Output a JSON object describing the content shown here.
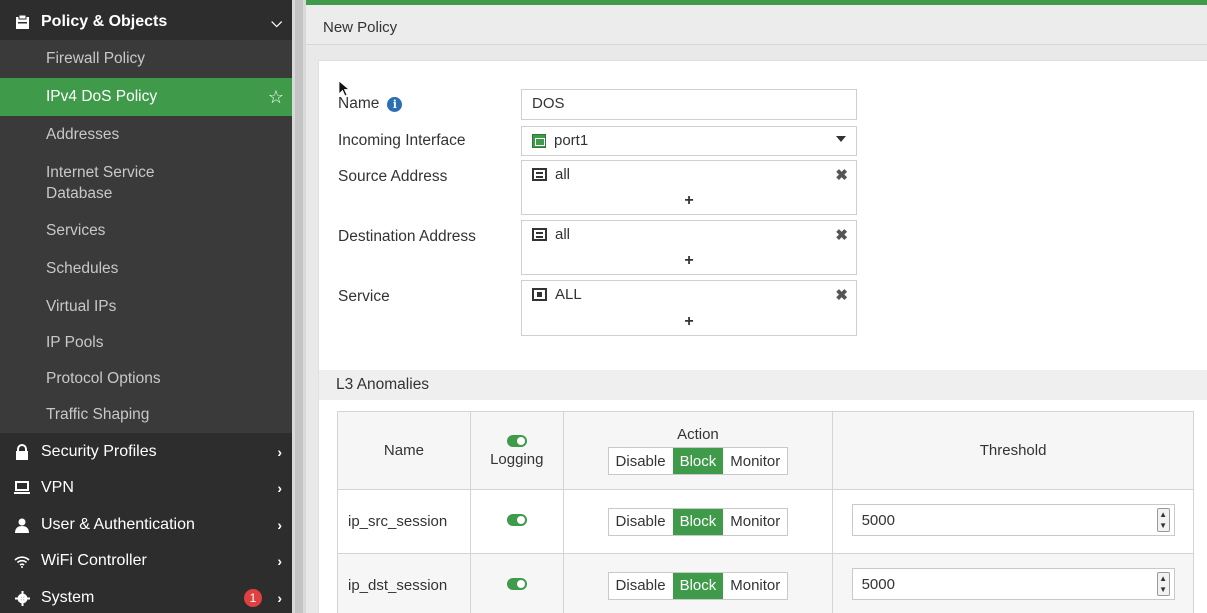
{
  "sidebar": {
    "section": {
      "label": "Policy & Objects",
      "icon": "clipboard-icon"
    },
    "items": [
      {
        "label": "Firewall Policy"
      },
      {
        "label": "IPv4 DoS Policy",
        "active": true
      },
      {
        "label": "Addresses"
      },
      {
        "label": "Internet Service\nDatabase"
      },
      {
        "label": "Services"
      },
      {
        "label": "Schedules"
      },
      {
        "label": "Virtual IPs"
      },
      {
        "label": "IP Pools"
      },
      {
        "label": "Protocol Options"
      },
      {
        "label": "Traffic Shaping"
      }
    ],
    "groups": [
      {
        "label": "Security Profiles",
        "icon": "lock-icon"
      },
      {
        "label": "VPN",
        "icon": "laptop-icon"
      },
      {
        "label": "User & Authentication",
        "icon": "user-icon"
      },
      {
        "label": "WiFi Controller",
        "icon": "wifi-icon"
      },
      {
        "label": "System",
        "icon": "gear-icon",
        "badge": "1"
      }
    ]
  },
  "page": {
    "title": "New Policy"
  },
  "form": {
    "name": {
      "label": "Name",
      "value": "DOS"
    },
    "incoming": {
      "label": "Incoming Interface",
      "value": "port1"
    },
    "source": {
      "label": "Source Address",
      "value": "all"
    },
    "destination": {
      "label": "Destination Address",
      "value": "all"
    },
    "service": {
      "label": "Service",
      "value": "ALL"
    },
    "add_symbol": "+",
    "remove_symbol": "✖"
  },
  "l3": {
    "title": "L3 Anomalies",
    "headers": {
      "name": "Name",
      "logging": "Logging",
      "action": "Action",
      "threshold": "Threshold"
    },
    "action_options": [
      "Disable",
      "Block",
      "Monitor"
    ],
    "rows": [
      {
        "name": "ip_src_session",
        "logging": true,
        "action": "Block",
        "threshold": "5000"
      },
      {
        "name": "ip_dst_session",
        "logging": true,
        "action": "Block",
        "threshold": "5000"
      }
    ]
  },
  "colors": {
    "accent": "#3f9b4a",
    "sidebar_bg": "#2d2d2d",
    "badge": "#e04040",
    "info": "#2a6fb5"
  }
}
